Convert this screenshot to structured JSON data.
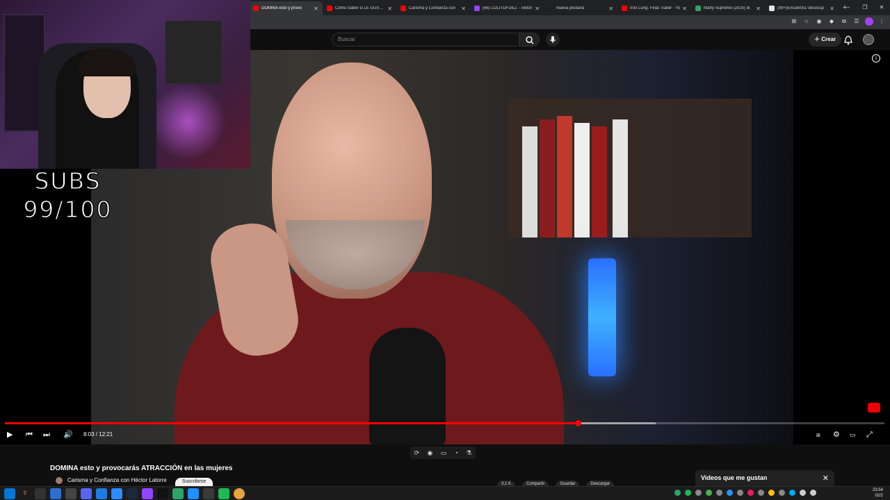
{
  "browser": {
    "tabs": [
      {
        "title": "DOMINA esto y provo",
        "favicon_color": "#ff0000",
        "active": true
      },
      {
        "title": "Cómo Saber si LE GUSTAS",
        "favicon_color": "#ff0000"
      },
      {
        "title": "Carisma y Confianza con",
        "favicon_color": "#ff0000"
      },
      {
        "title": "(66) LOLITOFDEZ - Twitch",
        "favicon_color": "#9146ff"
      },
      {
        "title": "Nueva pestaña",
        "favicon_color": "#1f1f1f"
      },
      {
        "title": "Iron Lung: Final Trailer - Yo",
        "favicon_color": "#ff0000"
      },
      {
        "title": "Marty Supreme (2025) di",
        "favicon_color": "#2ea36a"
      },
      {
        "title": "(99+)Encuentra 'desocup",
        "favicon_color": "#e6e6e6"
      }
    ],
    "new_tab_glyph": "+",
    "window_controls": [
      "–",
      "❐",
      "✕"
    ]
  },
  "youtube": {
    "search_placeholder": "Buscar",
    "create_label": "Crear"
  },
  "stream_overlay": {
    "subs_line1": "SUBS",
    "subs_line2": "99/100"
  },
  "player": {
    "time_current": "8:03",
    "time_total": "12:21",
    "timecode": "8:03 / 12:21",
    "played_fraction": 0.651,
    "buffered_fraction": 0.74,
    "accent": "#ff0000"
  },
  "video_info": {
    "title": "DOMINA esto y provocarás ATRACCIÓN en las mujeres",
    "channel": "Carisma y Confianza con Héctor Latorre",
    "subscribe_label": "Suscribirse",
    "actions": [
      "3,1 K",
      "Compartir",
      "Guardar",
      "Descargar"
    ]
  },
  "liked_panel": {
    "title": "Videos que me gustan",
    "close_glyph": "✕"
  },
  "taskbar": {
    "time": "23:54",
    "date": "02/2"
  }
}
